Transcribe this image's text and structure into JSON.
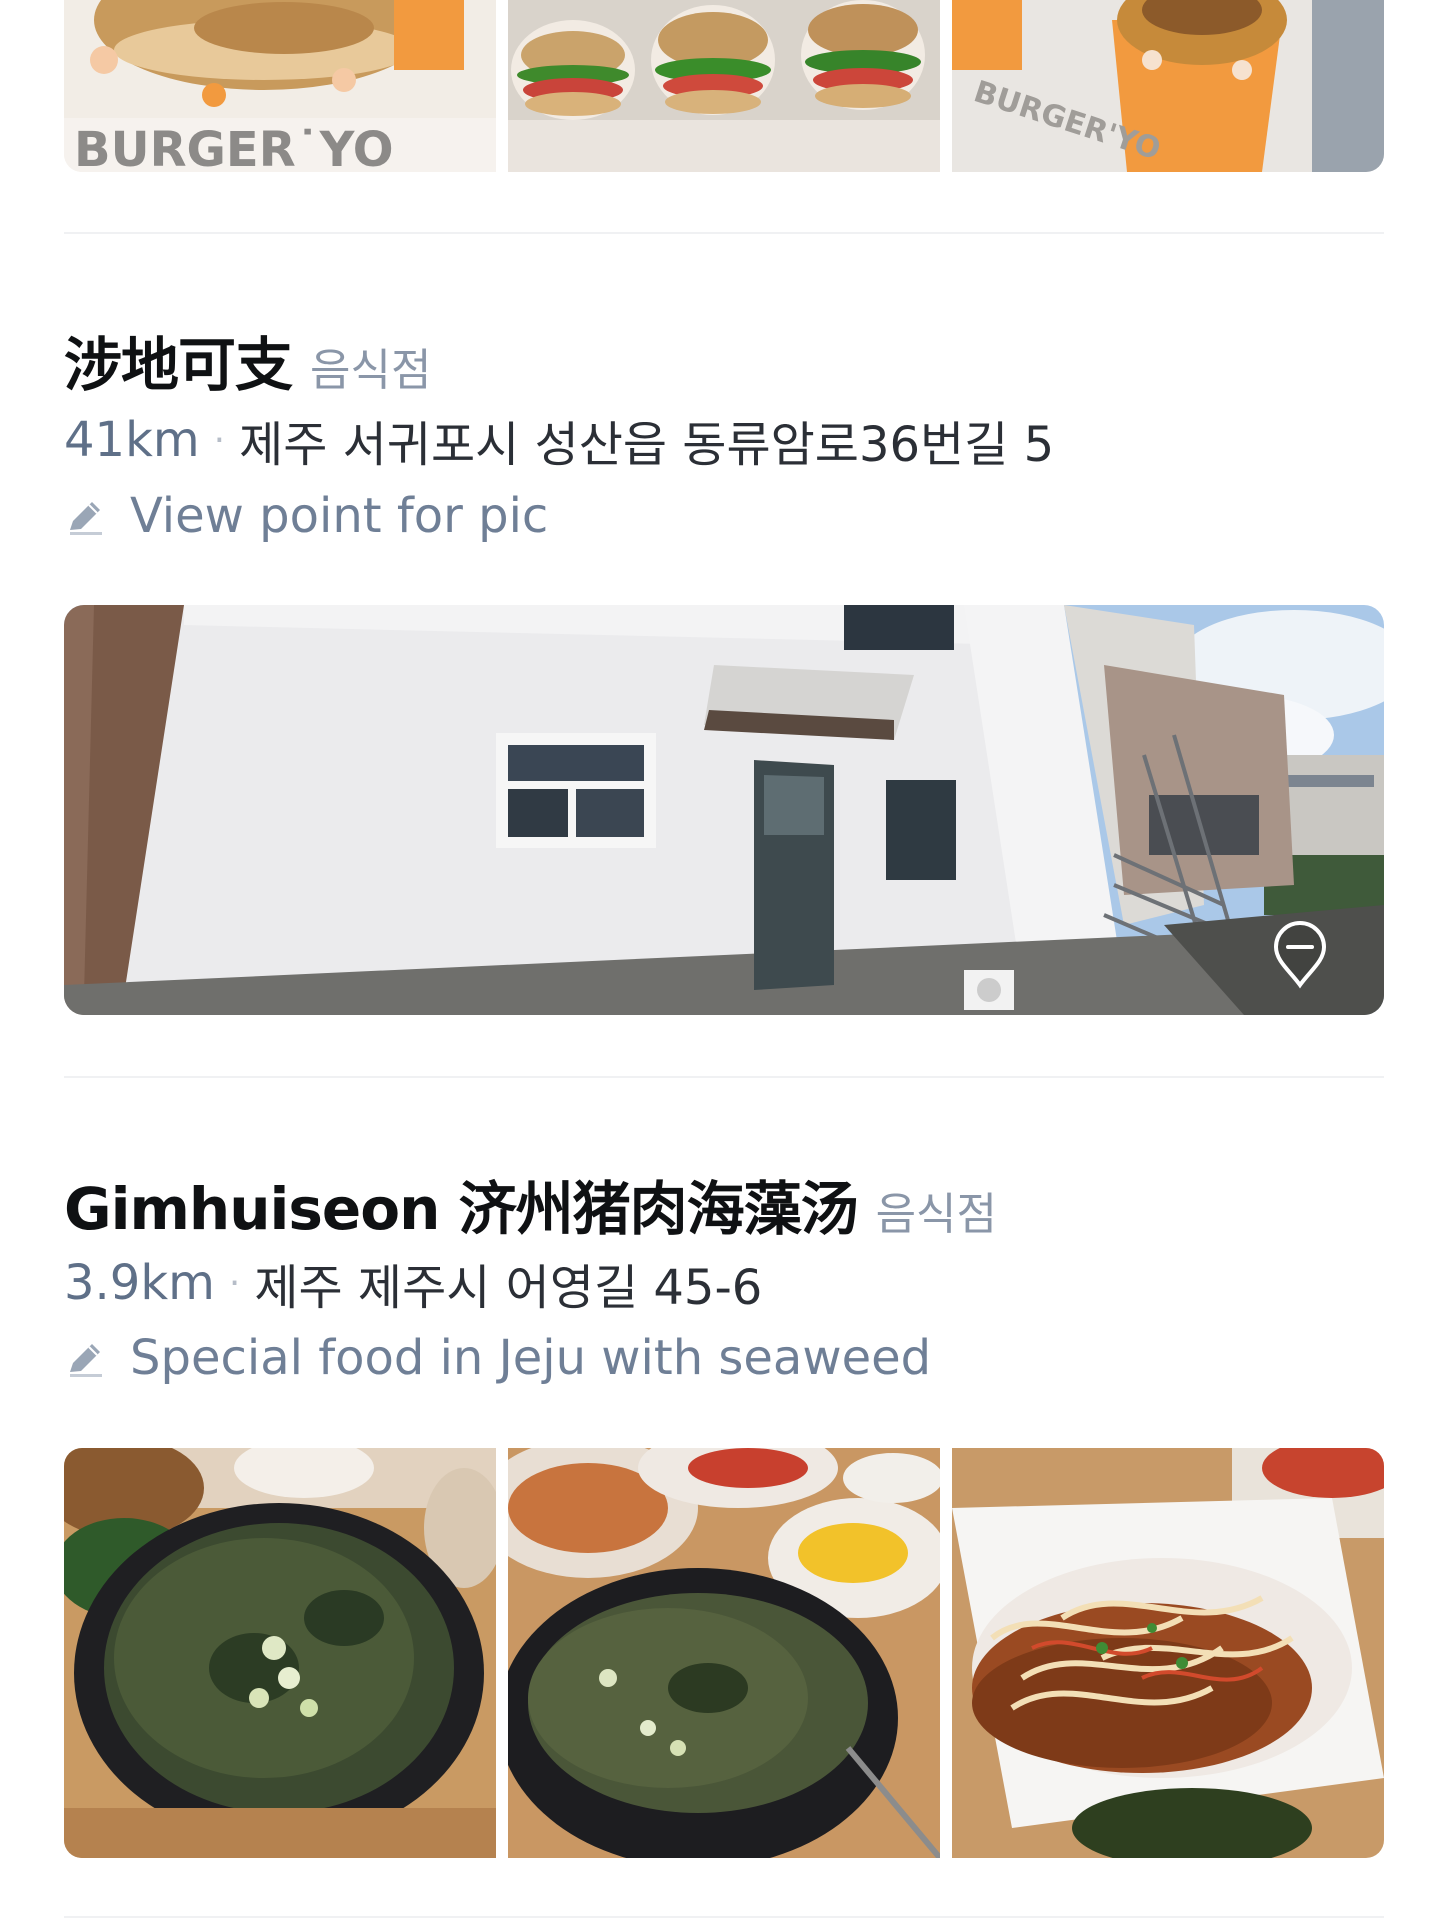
{
  "top_photos": {
    "watermark_left": "BURGER˙YO",
    "watermark_right": "BURGER'YO"
  },
  "places": [
    {
      "name": "涉地可支",
      "category": "음식점",
      "distance": "41km",
      "address": "제주 서귀포시 성산읍 동류암로36번길 5",
      "note": "View point for pic"
    },
    {
      "name": "Gimhuiseon 济州猪肉海藻汤",
      "category": "음식점",
      "distance": "3.9km",
      "address": "제주 제주시 어영길 45-6",
      "note": "Special food in Jeju with seaweed"
    }
  ],
  "separator": "·",
  "icons": {
    "note": "pencil-icon",
    "map_pin": "map-pin-icon"
  }
}
